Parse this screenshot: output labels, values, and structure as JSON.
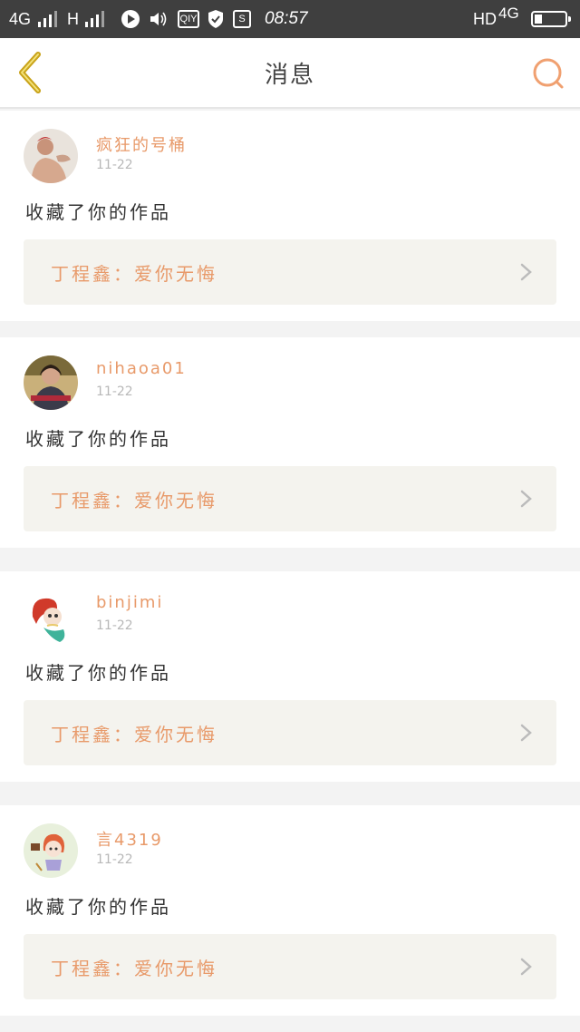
{
  "status_bar": {
    "network_left": "4G",
    "network_h": "H",
    "carrier_badge": "QIY",
    "s_badge": "S",
    "time": "08:57",
    "hd": "HD",
    "network_right": "4G"
  },
  "header": {
    "title": "消息"
  },
  "colors": {
    "accent": "#e89a6a",
    "back_arrow": "#c9a31a",
    "card_bg": "#f4f3ee"
  },
  "messages": [
    {
      "username": "疯狂的号桶",
      "date": "11-22",
      "action": "收藏了你的作品",
      "work": "丁程鑫：爱你无悔",
      "avatar_icon": "avatar-boy-photo"
    },
    {
      "username": "nihaoa01",
      "date": "11-22",
      "action": "收藏了你的作品",
      "work": "丁程鑫：爱你无悔",
      "avatar_icon": "avatar-girl-photo"
    },
    {
      "username": "binjimi",
      "date": "11-22",
      "action": "收藏了你的作品",
      "work": "丁程鑫：爱你无悔",
      "avatar_icon": "avatar-mermaid-cartoon"
    },
    {
      "username": "言4319",
      "date": "11-22",
      "action": "收藏了你的作品",
      "work": "丁程鑫：爱你无悔",
      "avatar_icon": "avatar-girl-cartoon"
    }
  ]
}
